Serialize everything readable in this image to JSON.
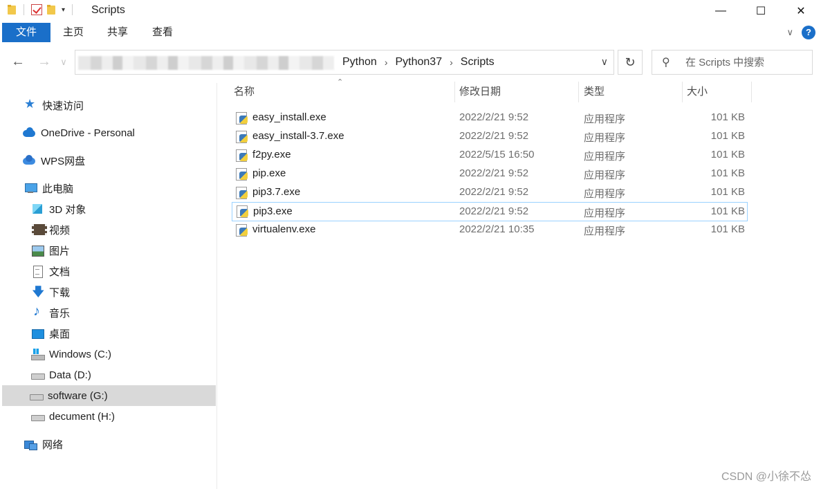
{
  "window": {
    "title": "Scripts",
    "controls": {
      "minimize": "—",
      "maximize": "☐",
      "close": "✕"
    }
  },
  "ribbon": {
    "tabs": [
      {
        "label": "文件",
        "active": true
      },
      {
        "label": "主页",
        "active": false
      },
      {
        "label": "共享",
        "active": false
      },
      {
        "label": "查看",
        "active": false
      }
    ],
    "help": "?"
  },
  "address": {
    "crumbs": [
      "Python",
      "Python37",
      "Scripts"
    ],
    "separator": "›"
  },
  "search": {
    "placeholder": "在 Scripts 中搜索"
  },
  "sidebar": {
    "items": [
      {
        "label": "快速访问",
        "icon": "star-icon"
      },
      {
        "label": "OneDrive - Personal",
        "icon": "cloud-icon"
      },
      {
        "label": "WPS网盘",
        "icon": "wps-cloud-icon"
      },
      {
        "label": "此电脑",
        "icon": "pc-icon"
      },
      {
        "label": "3D 对象",
        "icon": "cube-icon"
      },
      {
        "label": "视频",
        "icon": "video-icon"
      },
      {
        "label": "图片",
        "icon": "picture-icon"
      },
      {
        "label": "文档",
        "icon": "document-icon"
      },
      {
        "label": "下载",
        "icon": "download-icon"
      },
      {
        "label": "音乐",
        "icon": "music-icon"
      },
      {
        "label": "桌面",
        "icon": "desktop-icon"
      },
      {
        "label": "Windows (C:)",
        "icon": "windows-drive-icon"
      },
      {
        "label": "Data (D:)",
        "icon": "drive-icon"
      },
      {
        "label": "software (G:)",
        "icon": "drive-icon",
        "selected": true
      },
      {
        "label": "decument (H:)",
        "icon": "drive-icon"
      },
      {
        "label": "网络",
        "icon": "network-icon"
      }
    ]
  },
  "columns": {
    "name": "名称",
    "date": "修改日期",
    "type": "类型",
    "size": "大小"
  },
  "files": [
    {
      "name": "easy_install.exe",
      "date": "2022/2/21 9:52",
      "type": "应用程序",
      "size": "101 KB"
    },
    {
      "name": "easy_install-3.7.exe",
      "date": "2022/2/21 9:52",
      "type": "应用程序",
      "size": "101 KB"
    },
    {
      "name": "f2py.exe",
      "date": "2022/5/15 16:50",
      "type": "应用程序",
      "size": "101 KB"
    },
    {
      "name": "pip.exe",
      "date": "2022/2/21 9:52",
      "type": "应用程序",
      "size": "101 KB"
    },
    {
      "name": "pip3.7.exe",
      "date": "2022/2/21 9:52",
      "type": "应用程序",
      "size": "101 KB"
    },
    {
      "name": "pip3.exe",
      "date": "2022/2/21 9:52",
      "type": "应用程序",
      "size": "101 KB",
      "selected": true
    },
    {
      "name": "virtualenv.exe",
      "date": "2022/2/21 10:35",
      "type": "应用程序",
      "size": "101 KB"
    }
  ],
  "watermark": "CSDN @小徐不怂",
  "colors": {
    "accent": "#1a6fc9",
    "selection": "#d9d9d9",
    "row_border": "#99d1ff"
  }
}
